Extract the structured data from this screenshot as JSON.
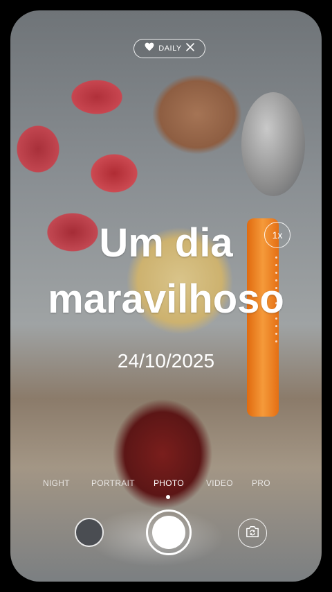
{
  "chip": {
    "label": "DAILY"
  },
  "overlay": {
    "line1": "Um dia",
    "line2": "maravilhoso",
    "date": "24/10/2025"
  },
  "zoom": {
    "label": "1x"
  },
  "modes": [
    {
      "label": "NIGHT"
    },
    {
      "label": "PORTRAIT"
    },
    {
      "label": "PHOTO"
    },
    {
      "label": "VIDEO"
    },
    {
      "label": "PRO"
    }
  ],
  "active_mode": "PHOTO",
  "icons": {
    "chip_heart": "heart-icon",
    "chip_close": "close-icon",
    "flip": "camera-flip-icon"
  },
  "colors": {
    "accent": "#ffffff",
    "background": "#000000"
  }
}
